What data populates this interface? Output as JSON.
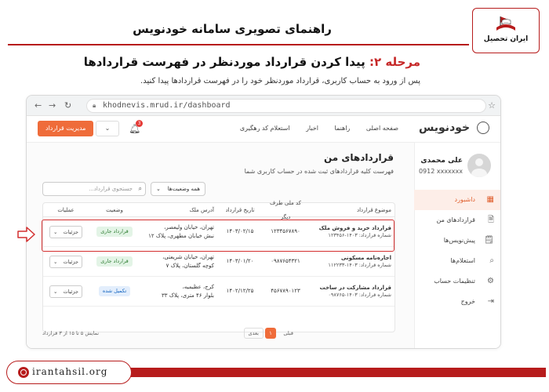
{
  "page": {
    "title": "راهنمای تصویری سامانه خودنویس",
    "step_label": "مرحله ۲:",
    "step_title": "پیدا کردن قرارداد موردنظر در فهرست قراردادها",
    "step_desc": "پس از ورود به حساب کاربری، قرارداد موردنظر خود را در فهرست قراردادها پیدا کنید.",
    "logo_caption": "ایران تحصیل",
    "footer_url": "irantahsil.org",
    "accent_color": "#b71c1c"
  },
  "browser": {
    "url": "khodnevis.mrud.ir/dashboard"
  },
  "app": {
    "brand": "خودنویس",
    "nav": [
      "صفحه اصلی",
      "راهنما",
      "اخبار",
      "استعلام کد رهگیری"
    ],
    "manage_button": "مدیریت قرارداد",
    "notifications": "3",
    "accent_color": "#ef6c3a"
  },
  "sidebar": {
    "user_name": "علی محمدی",
    "user_phone": "0912 xxxxxxx",
    "items": [
      {
        "label": "داشبورد",
        "icon": "grid-icon",
        "active": true
      },
      {
        "label": "قراردادهای من",
        "icon": "file-icon"
      },
      {
        "label": "پیش‌نویس‌ها",
        "icon": "document-icon"
      },
      {
        "label": "استعلام‌ها",
        "icon": "search-icon"
      },
      {
        "label": "تنظیمات حساب",
        "icon": "gear-icon"
      },
      {
        "label": "خروج",
        "icon": "logout-icon"
      }
    ]
  },
  "main": {
    "title": "قراردادهای من",
    "subtitle": "فهرست کلیه قراردادهای ثبت شده در حساب کاربری شما",
    "filter": "همه وضعیت‌ها",
    "search_placeholder": "جستجوی قرارداد...",
    "columns": [
      "موضوع قرارداد",
      "کد ملی طرف دیگر",
      "تاریخ قرارداد",
      "آدرس ملک",
      "وضعیت",
      "عملیات"
    ],
    "rows": [
      {
        "title": "قرارداد خرید و فروش ملک",
        "number": "شماره قرارداد: ۱۴۰۳-۱۲۳۴۵۶",
        "national_id": "۱۲۳۴۵۶۷۸۹۰",
        "date": "۱۴۰۳/۰۲/۱۵",
        "address_1": "تهران، خیابان ولیعصر،",
        "address_2": "نبش خیابان مطهری، پلاک ۱۲",
        "status": "قرارداد جاری",
        "status_type": "green",
        "action": "جزئیات"
      },
      {
        "title": "اجاره‌نامه مسکونی",
        "number": "شماره قرارداد: ۱۴۰۳-۱۱۲۲۳۳",
        "national_id": "۰۹۸۷۶۵۴۳۲۱",
        "date": "۱۴۰۳/۰۱/۲۰",
        "address_1": "تهران، خیابان شریعتی،",
        "address_2": "کوچه گلستان، پلاک ۷",
        "status": "قرارداد جاری",
        "status_type": "green",
        "action": "جزئیات"
      },
      {
        "title": "قرارداد مشارکت در ساخت",
        "number": "شماره قرارداد: ۱۴۰۳-۰۹۸۷۶۵",
        "national_id": "۴۵۶۷۸۹۰۱۲۳",
        "date": "۱۴۰۲/۱۲/۲۵",
        "address_1": "کرج، عظیمیه،",
        "address_2": "بلوار ۴۶ متری، پلاک ۳۳",
        "status": "تکمیل شده",
        "status_type": "blue",
        "action": "جزئیات"
      }
    ],
    "pager": {
      "prev": "قبلی",
      "current": "۱",
      "next": "بعدی",
      "info": "نمایش ۵ تا ۱۵ از ۳ قرارداد"
    }
  }
}
